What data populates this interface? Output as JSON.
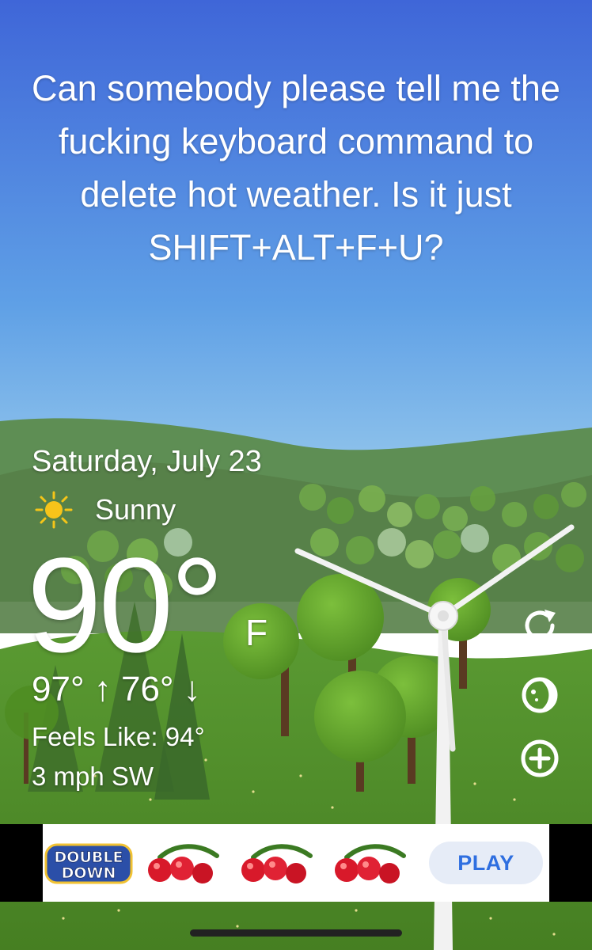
{
  "message": {
    "text": "Can somebody please tell me the fucking keyboard command to delete hot weather. Is it just SHIFT+ALT+F+U?"
  },
  "weather": {
    "date": "Saturday, July 23",
    "condition": "Sunny",
    "condition_icon": "sun-icon",
    "temperature": "90°",
    "unit": "F",
    "high_low": "97° ↑ 76° ↓",
    "feels_like": "Feels Like: 94°",
    "wind": "3 mph SW"
  },
  "side_controls": {
    "refresh_icon": "refresh-icon",
    "theme_icon": "moon-theme-icon",
    "add_icon": "add-location-icon"
  },
  "ad": {
    "brand": "DOUBLE DOWN",
    "symbol_icon": "cherries-icon",
    "symbol_count": 3,
    "cta": "PLAY"
  },
  "colors": {
    "sky_top": "#3f68d8",
    "sky_bottom": "#a7d3ee",
    "grass": "#4e8a2a",
    "play_text": "#2f6fe0"
  }
}
